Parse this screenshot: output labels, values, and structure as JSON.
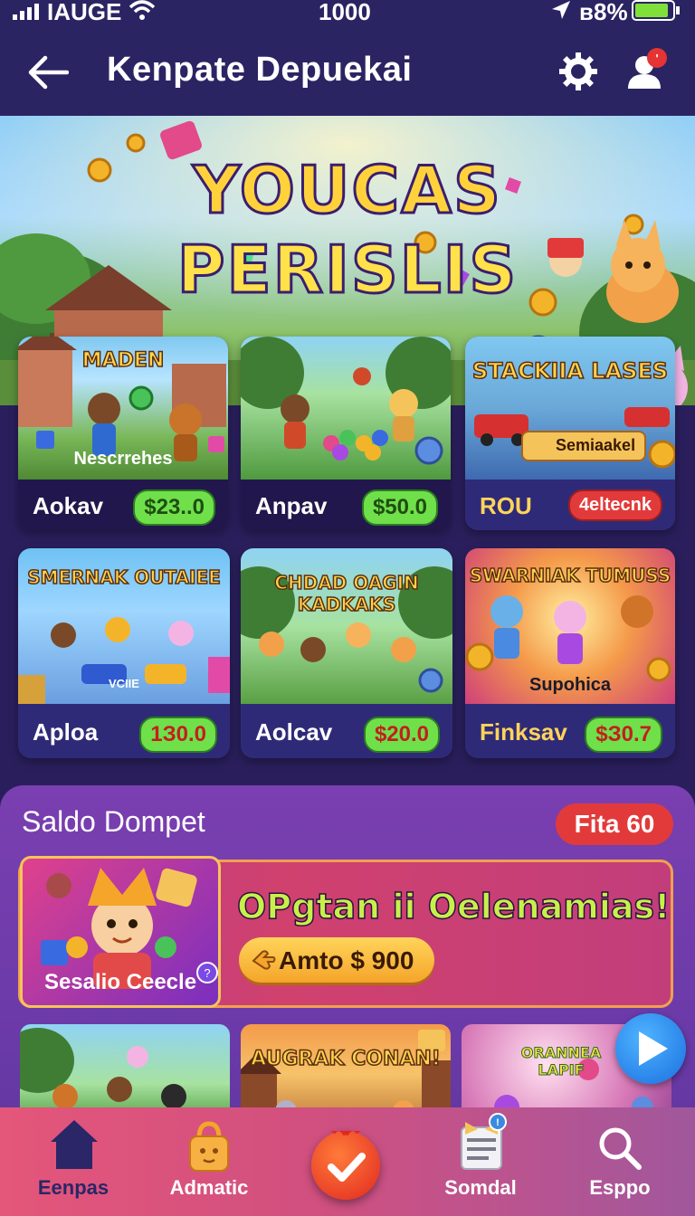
{
  "status_bar": {
    "carrier": "IAUGE",
    "time": "1000",
    "battery": "ʙ8%"
  },
  "header": {
    "title": "Kenpate Depuekai",
    "icons": [
      "back-arrow-icon",
      "gear-icon",
      "profile-icon"
    ]
  },
  "hero": {
    "title_line1": "YOUCAS",
    "title_line2": "PERISLIS"
  },
  "cards": [
    {
      "art_title": "MADEN",
      "art_label": "Nescrrehes",
      "name": "Aokav",
      "price": "$23..0",
      "price_style": "green"
    },
    {
      "art_title": "",
      "art_label": "",
      "name": "Anpav",
      "price": "$50.0",
      "price_style": "green"
    },
    {
      "art_title": "STACKIIA LASES",
      "art_label": "Semiaakel",
      "name": "ROU",
      "price": "4eltecnk",
      "price_style": "red"
    },
    {
      "art_title": "SMERNAK OUTAIEE",
      "art_label": "VCIIE",
      "name": "Aploa",
      "price": "1З0.0",
      "price_style": "green"
    },
    {
      "art_title": "CHDAD OAGIN KADKAKS",
      "art_label": "",
      "name": "Aolcav",
      "price": "$20.0",
      "price_style": "green"
    },
    {
      "art_title": "SWARNIAK TUMUSS",
      "art_label": "Supohica",
      "name": "Finksav",
      "price": "$З0.7",
      "price_style": "green"
    }
  ],
  "wallet": {
    "title": "Saldo Dompet",
    "badge": "Fita 60",
    "promo": {
      "caption": "Sesalio Ceecle",
      "headline": "OPgtan ii Oelenamias!",
      "button": "Amto $ 900"
    },
    "thumbnails": [
      {
        "title": ""
      },
      {
        "title": "AUGRAK CONAN!"
      },
      {
        "title": "ORANNEA LAPIF"
      }
    ]
  },
  "bottom_nav": {
    "items": [
      {
        "label": "Eenpas",
        "icon": "home-icon"
      },
      {
        "label": "Admatic",
        "icon": "bag-icon"
      },
      {
        "label": "",
        "icon": "check-icon"
      },
      {
        "label": "Somdal",
        "icon": "notes-icon"
      },
      {
        "label": "Esppo",
        "icon": "search-icon"
      }
    ]
  },
  "colors": {
    "header_bg": "#2b2463",
    "price_green": "#6fe04a",
    "badge_red": "#e23a3a",
    "nav_gradient_start": "#e4567a",
    "nav_gradient_end": "#a0579c"
  }
}
